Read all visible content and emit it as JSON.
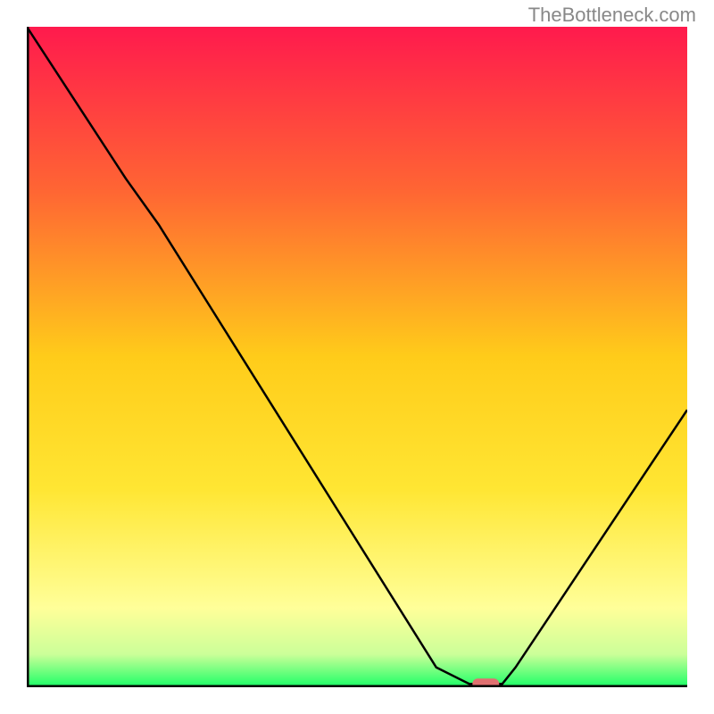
{
  "watermark": "TheBottleneck.com",
  "chart_data": {
    "type": "line",
    "title": "",
    "xlabel": "",
    "ylabel": "",
    "xlim": [
      0,
      100
    ],
    "ylim": [
      0,
      100
    ],
    "series": [
      {
        "name": "bottleneck-curve",
        "x": [
          0,
          15,
          20,
          62,
          67,
          72,
          74,
          100
        ],
        "y": [
          100,
          77,
          70,
          3,
          0.5,
          0.5,
          3,
          42
        ],
        "color": "#000000"
      }
    ],
    "optimal_marker": {
      "x": 69.5,
      "y": 0.5,
      "color": "#e07070"
    },
    "background_gradient": {
      "type": "vertical",
      "stops": [
        {
          "offset": 0,
          "color": "#ff1a4d"
        },
        {
          "offset": 25,
          "color": "#ff6633"
        },
        {
          "offset": 50,
          "color": "#ffcc1a"
        },
        {
          "offset": 70,
          "color": "#ffe633"
        },
        {
          "offset": 88,
          "color": "#ffff99"
        },
        {
          "offset": 95,
          "color": "#ccff99"
        },
        {
          "offset": 100,
          "color": "#1aff66"
        }
      ]
    },
    "axes_color": "#000000"
  }
}
